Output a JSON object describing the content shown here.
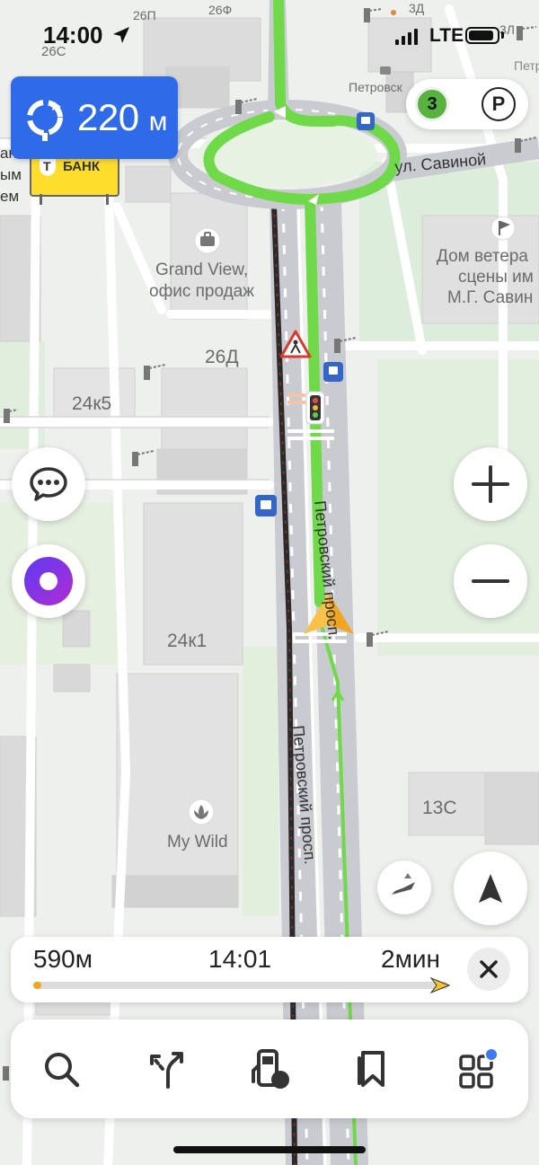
{
  "status_bar": {
    "time": "14:00",
    "network": "LTE"
  },
  "maneuver": {
    "distance_value": "220",
    "distance_unit": "м",
    "icon": "roundabout-icon"
  },
  "map": {
    "labels": {
      "b_26s": "26С",
      "b_26p": "26П",
      "b_26f": "26Ф",
      "b_3d": "3Д",
      "b_3l": "3Л",
      "petr_top": "Петровск",
      "petr_right": "Петр",
      "b_26d": "26Д",
      "b_24k5": "24к5",
      "b_24k1": "24к1",
      "b_13s": "13С",
      "grand_view_1": "Grand View,",
      "grand_view_2": "офис продаж",
      "my_wild": "My Wild",
      "dom_1": "Дом ветера",
      "dom_2": "сцены им",
      "dom_3": "М.Г. Савин",
      "left_frag_1": "ан",
      "left_frag_2": "ым",
      "left_frag_3": "ем",
      "street_savina": "ул. Савиной",
      "street_petr_1": "Петровский просп.",
      "street_petr_2": "Петровский просп.",
      "bank": "БАНК",
      "bank_letter": "Т"
    }
  },
  "traffic_score": "3",
  "parking_label": "P",
  "route": {
    "distance": "590м",
    "arrival": "14:01",
    "duration": "2мин",
    "progress": 0.02
  },
  "colors": {
    "accent": "#2f6ae8",
    "route": "#6fd94a",
    "traffic": "#57b33e",
    "bank": "#ffdd2d"
  },
  "icons": {
    "chat": "chat-icon",
    "alice": "alice-icon",
    "zoom_in": "plus-icon",
    "zoom_out": "minus-icon",
    "compass": "compass-icon",
    "locate": "navigation-arrow-icon",
    "close": "close-icon",
    "search": "search-icon",
    "routes": "route-fork-icon",
    "fuel": "fuel-station-icon",
    "bookmarks": "bookmark-icon",
    "services": "services-grid-icon"
  }
}
